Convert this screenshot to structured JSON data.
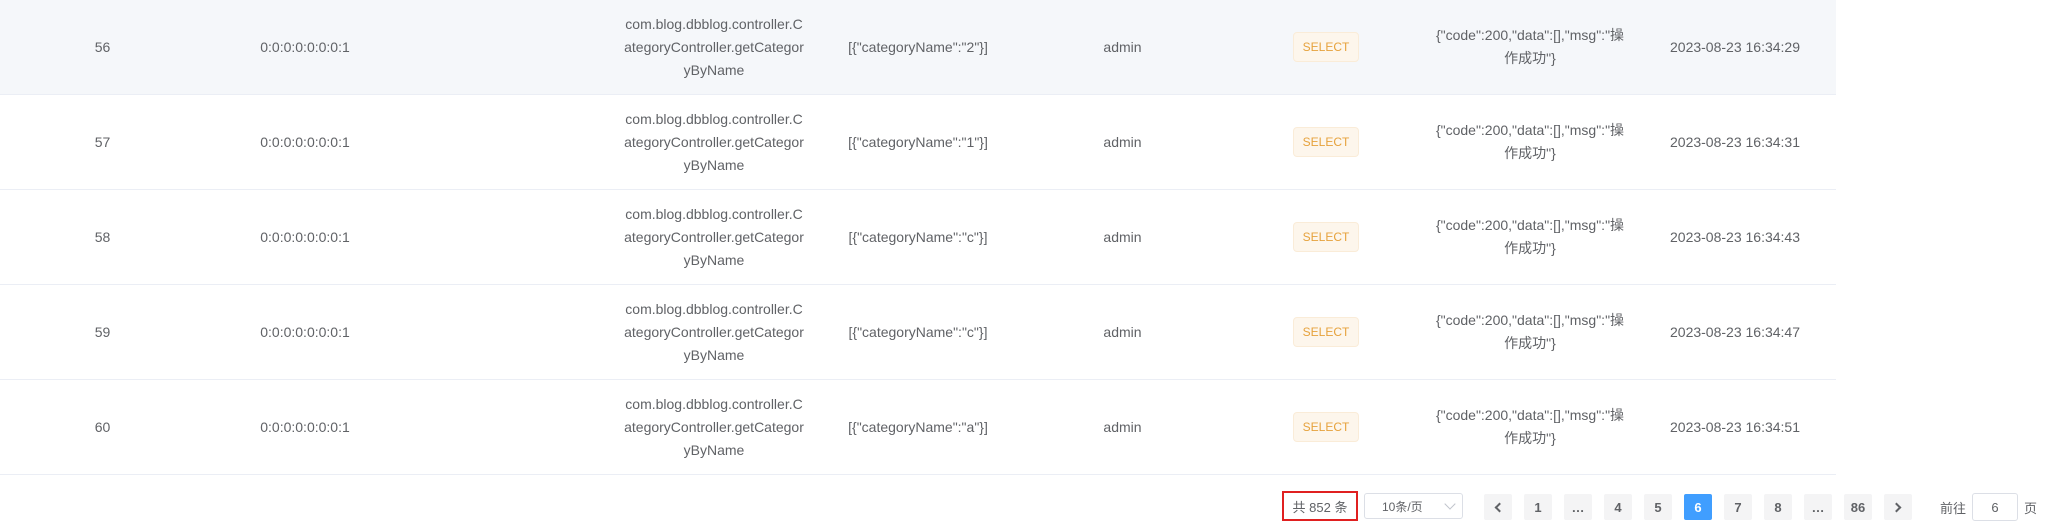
{
  "table": {
    "rows": [
      {
        "id": "56",
        "ip": "0:0:0:0:0:0:0:1",
        "method": "com.blog.dbblog.controller.CategoryController.getCategoryByName",
        "params": "[{\"categoryName\":\"2\"}]",
        "user": "admin",
        "type": "SELECT",
        "result": "{\"code\":200,\"data\":[],\"msg\":\"操作成功\"}",
        "time": "2023-08-23 16:34:29"
      },
      {
        "id": "57",
        "ip": "0:0:0:0:0:0:0:1",
        "method": "com.blog.dbblog.controller.CategoryController.getCategoryByName",
        "params": "[{\"categoryName\":\"1\"}]",
        "user": "admin",
        "type": "SELECT",
        "result": "{\"code\":200,\"data\":[],\"msg\":\"操作成功\"}",
        "time": "2023-08-23 16:34:31"
      },
      {
        "id": "58",
        "ip": "0:0:0:0:0:0:0:1",
        "method": "com.blog.dbblog.controller.CategoryController.getCategoryByName",
        "params": "[{\"categoryName\":\"c\"}]",
        "user": "admin",
        "type": "SELECT",
        "result": "{\"code\":200,\"data\":[],\"msg\":\"操作成功\"}",
        "time": "2023-08-23 16:34:43"
      },
      {
        "id": "59",
        "ip": "0:0:0:0:0:0:0:1",
        "method": "com.blog.dbblog.controller.CategoryController.getCategoryByName",
        "params": "[{\"categoryName\":\"c\"}]",
        "user": "admin",
        "type": "SELECT",
        "result": "{\"code\":200,\"data\":[],\"msg\":\"操作成功\"}",
        "time": "2023-08-23 16:34:47"
      },
      {
        "id": "60",
        "ip": "0:0:0:0:0:0:0:1",
        "method": "com.blog.dbblog.controller.CategoryController.getCategoryByName",
        "params": "[{\"categoryName\":\"a\"}]",
        "user": "admin",
        "type": "SELECT",
        "result": "{\"code\":200,\"data\":[],\"msg\":\"操作成功\"}",
        "time": "2023-08-23 16:34:51"
      }
    ]
  },
  "pagination": {
    "total": "共 852 条",
    "page_size": "10条/页",
    "pages": [
      "1",
      "…",
      "4",
      "5",
      "6",
      "7",
      "8",
      "…",
      "86"
    ],
    "current": "6",
    "goto_prefix": "前往",
    "goto_value": "6",
    "goto_suffix": "页"
  },
  "colors": {
    "accent": "#409eff",
    "tag_text": "#e6a23c",
    "tag_bg": "#fdf6ec",
    "highlight_border": "#e02020"
  }
}
